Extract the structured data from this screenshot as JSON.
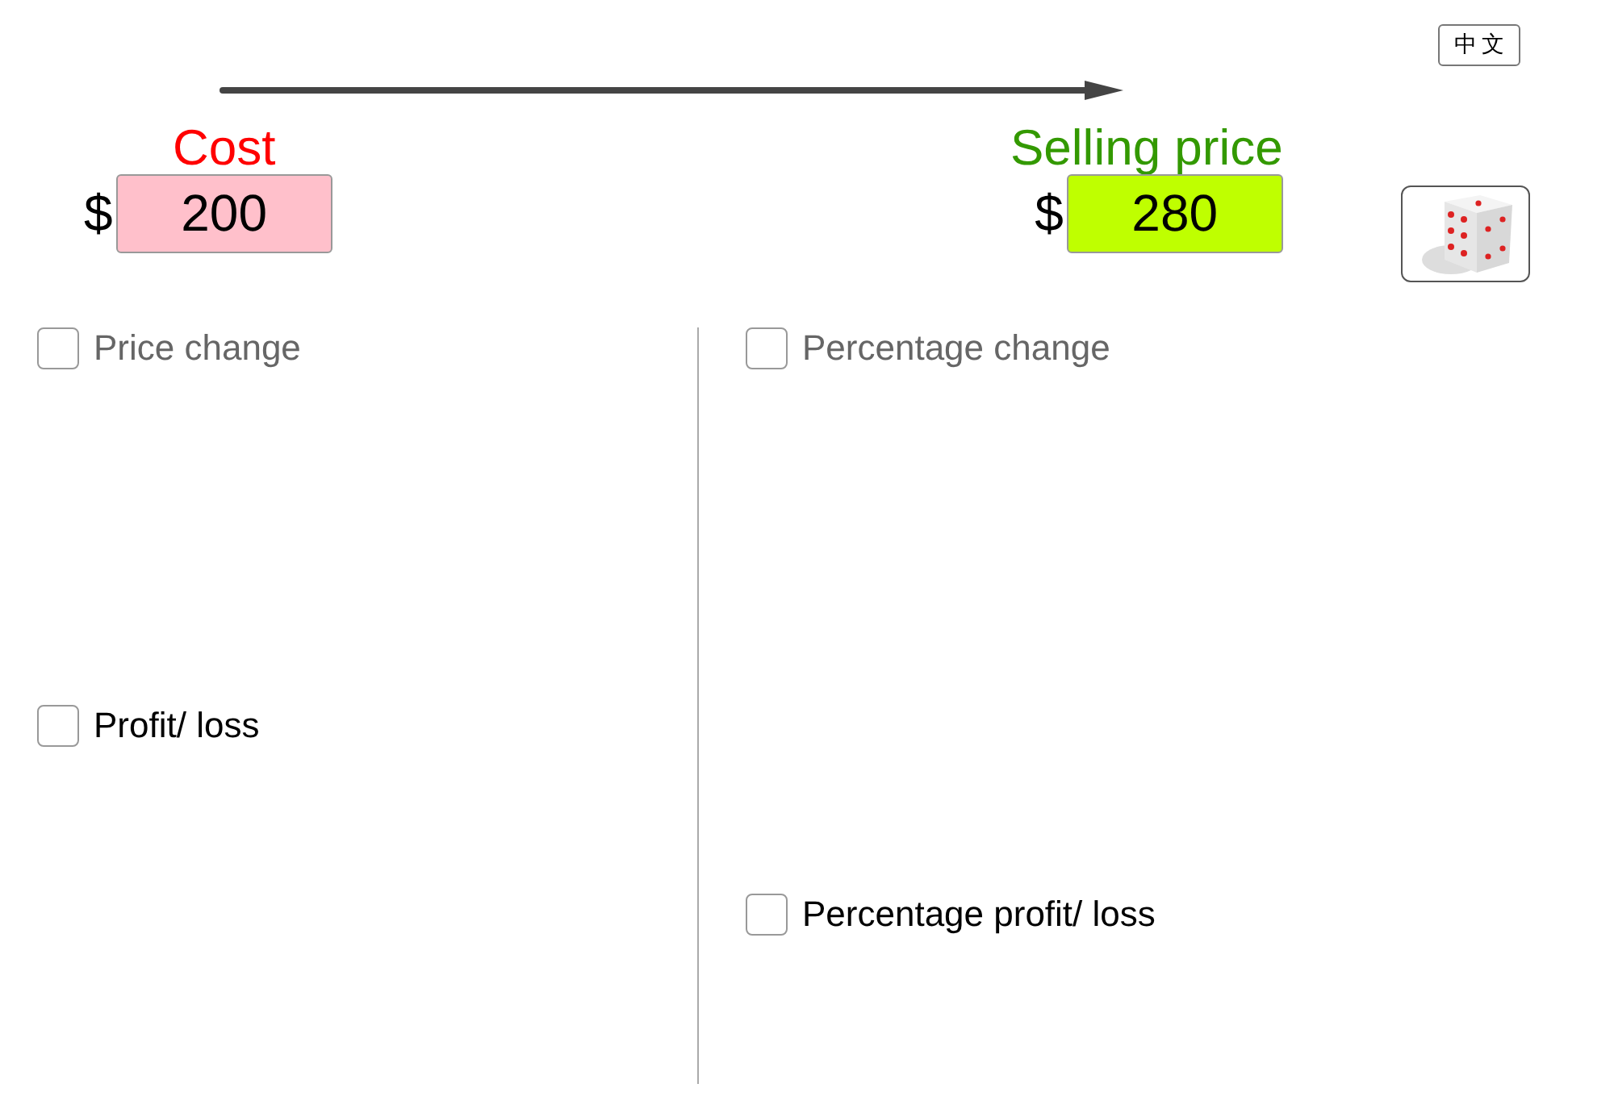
{
  "language_button": {
    "label": "中文"
  },
  "prices": [
    {
      "label": "Cost",
      "color": "#ff0000",
      "currency": "$",
      "field": {
        "value": "200",
        "color": "#ffc0cb"
      }
    },
    {
      "label": "Selling price",
      "color": "#339900",
      "currency": "$",
      "field": {
        "value": "280",
        "color": "#bfff00"
      }
    }
  ],
  "checkboxes": [
    {
      "label": "Price change",
      "checked": false,
      "disabled": true
    },
    {
      "label": "Profit/ loss",
      "checked": false,
      "disabled": false
    },
    {
      "label": "Percentage change",
      "checked": false,
      "disabled": true
    },
    {
      "label": "Percentage profit/ loss",
      "checked": false,
      "disabled": false
    }
  ]
}
